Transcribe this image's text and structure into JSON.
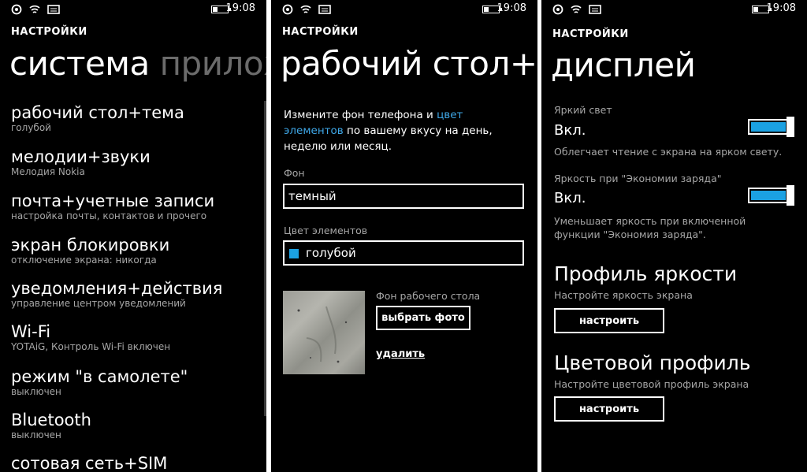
{
  "status": {
    "time": "19:08"
  },
  "left": {
    "header": "НАСТРОЙКИ",
    "title_main": "система",
    "title_next": "прилож",
    "items": [
      {
        "title": "рабочий стол+тема",
        "sub": "голубой"
      },
      {
        "title": "мелодии+звуки",
        "sub": "Мелодия Nokia"
      },
      {
        "title": "почта+учетные записи",
        "sub": "настройка почты, контактов и прочего"
      },
      {
        "title": "экран блокировки",
        "sub": "отключение экрана: никогда"
      },
      {
        "title": "уведомления+действия",
        "sub": "управление центром уведомлений"
      },
      {
        "title": "Wi-Fi",
        "sub": "YOTAiG, Контроль Wi-Fi включен"
      },
      {
        "title": "режим \"в самолете\"",
        "sub": "выключен"
      },
      {
        "title": "Bluetooth",
        "sub": "выключен"
      },
      {
        "title": "сотовая сеть+SIM",
        "sub": ""
      }
    ]
  },
  "middle": {
    "header": "НАСТРОЙКИ",
    "title": "рабочий стол+т",
    "desc_part1": "Измените фон телефона и ",
    "desc_link": "цвет элементов",
    "desc_part2": "по вашему вкусу на день, неделю или месяц.",
    "bg_label": "Фон",
    "bg_value": "темный",
    "accent_label": "Цвет элементов",
    "accent_value": "голубой",
    "accent_color": "#1ba1e2",
    "wallpaper_label": "Фон рабочего стола",
    "choose_photo": "выбрать фото",
    "delete": "удалить"
  },
  "right": {
    "header": "НАСТРОЙКИ",
    "title": "дисплей",
    "bright_label": "Яркий свет",
    "bright_state": "Вкл.",
    "bright_desc": "Облегчает чтение с экрана на ярком свету.",
    "saver_label": "Яркость при \"Экономии заряда\"",
    "saver_state": "Вкл.",
    "saver_desc": "Уменьшает яркость при включенной функции \"Экономия заряда\".",
    "profile_title": "Профиль яркости",
    "profile_desc": "Настройте яркость экрана",
    "profile_btn": "настроить",
    "color_title": "Цветовой профиль",
    "color_desc": "Настройте цветовой профиль экрана",
    "color_btn": "настроить"
  }
}
